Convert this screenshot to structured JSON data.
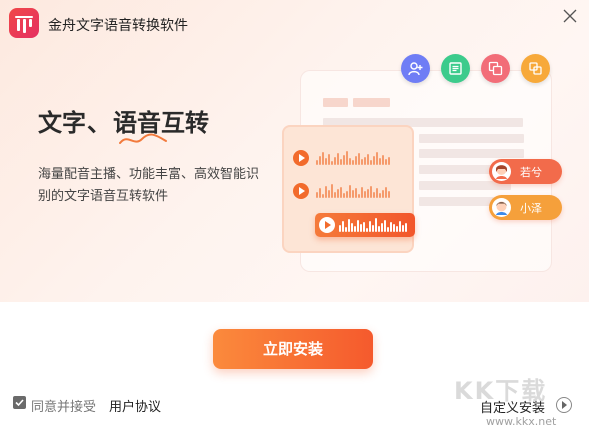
{
  "window": {
    "title": "金舟文字语音转换软件"
  },
  "hero": {
    "headline_part1": "文字",
    "headline_sep": "、",
    "headline_part2": "语音互转",
    "description_line1": "海量配音主播、功能丰富、高效智能识",
    "description_line2": "别的文字语音互转软件"
  },
  "illustration": {
    "tool_icons": [
      {
        "name": "user-add-icon",
        "color": "#6f7df5"
      },
      {
        "name": "document-icon",
        "color": "#3ccb8c"
      },
      {
        "name": "image-convert-icon",
        "color": "#f26d78"
      },
      {
        "name": "copy-icon",
        "color": "#f7a93a"
      }
    ],
    "voices": [
      {
        "name": "若兮",
        "color": "#f26b4b"
      },
      {
        "name": "小泽",
        "color": "#f5a03b"
      }
    ]
  },
  "install": {
    "label": "立即安装"
  },
  "agreement": {
    "checked": true,
    "text": "同意并接受",
    "link": "用户协议"
  },
  "custom_install": {
    "label": "自定义安装"
  },
  "watermark": {
    "text": "KK下载",
    "url": "www.kkx.net"
  },
  "colors": {
    "accent": "#f55a2d",
    "accent_light": "#fb8a3c",
    "logo": "#e8365a"
  }
}
